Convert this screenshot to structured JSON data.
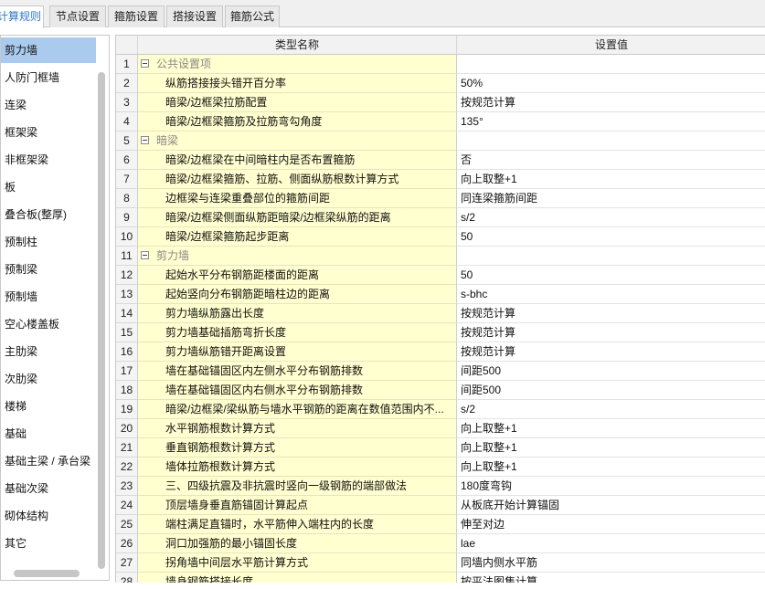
{
  "tabs": [
    {
      "label": "计算规则"
    },
    {
      "label": "节点设置"
    },
    {
      "label": "箍筋设置"
    },
    {
      "label": "搭接设置"
    },
    {
      "label": "箍筋公式"
    }
  ],
  "sidebar": {
    "items": [
      {
        "label": "剪力墙"
      },
      {
        "label": "人防门框墙"
      },
      {
        "label": "连梁"
      },
      {
        "label": "框架梁"
      },
      {
        "label": "非框架梁"
      },
      {
        "label": "板"
      },
      {
        "label": "叠合板(整厚)"
      },
      {
        "label": "预制柱"
      },
      {
        "label": "预制梁"
      },
      {
        "label": "预制墙"
      },
      {
        "label": "空心楼盖板"
      },
      {
        "label": "主肋梁"
      },
      {
        "label": "次肋梁"
      },
      {
        "label": "楼梯"
      },
      {
        "label": "基础"
      },
      {
        "label": "基础主梁 / 承台梁"
      },
      {
        "label": "基础次梁"
      },
      {
        "label": "砌体结构"
      },
      {
        "label": "其它"
      }
    ]
  },
  "grid": {
    "header": {
      "name": "类型名称",
      "value": "设置值"
    },
    "rows": [
      {
        "num": "1",
        "name": "公共设置项",
        "value": "",
        "group": true
      },
      {
        "num": "2",
        "name": "纵筋搭接接头错开百分率",
        "value": "50%"
      },
      {
        "num": "3",
        "name": "暗梁/边框梁拉筋配置",
        "value": "按规范计算"
      },
      {
        "num": "4",
        "name": "暗梁/边框梁箍筋及拉筋弯勾角度",
        "value": "135°"
      },
      {
        "num": "5",
        "name": "暗梁",
        "value": "",
        "group": true
      },
      {
        "num": "6",
        "name": "暗梁/边框梁在中间暗柱内是否布置箍筋",
        "value": "否"
      },
      {
        "num": "7",
        "name": "暗梁/边框梁箍筋、拉筋、侧面纵筋根数计算方式",
        "value": "向上取整+1"
      },
      {
        "num": "8",
        "name": "边框梁与连梁重叠部位的箍筋间距",
        "value": "同连梁箍筋间距"
      },
      {
        "num": "9",
        "name": "暗梁/边框梁侧面纵筋距暗梁/边框梁纵筋的距离",
        "value": "s/2"
      },
      {
        "num": "10",
        "name": "暗梁/边框梁箍筋起步距离",
        "value": "50"
      },
      {
        "num": "11",
        "name": "剪力墙",
        "value": "",
        "group": true
      },
      {
        "num": "12",
        "name": "起始水平分布钢筋距楼面的距离",
        "value": "50"
      },
      {
        "num": "13",
        "name": "起始竖向分布钢筋距暗柱边的距离",
        "value": "s-bhc"
      },
      {
        "num": "14",
        "name": "剪力墙纵筋露出长度",
        "value": "按规范计算"
      },
      {
        "num": "15",
        "name": "剪力墙基础插筋弯折长度",
        "value": "按规范计算"
      },
      {
        "num": "16",
        "name": "剪力墙纵筋错开距离设置",
        "value": "按规范计算"
      },
      {
        "num": "17",
        "name": "墙在基础锚固区内左侧水平分布钢筋排数",
        "value": "间距500"
      },
      {
        "num": "18",
        "name": "墙在基础锚固区内右侧水平分布钢筋排数",
        "value": "间距500"
      },
      {
        "num": "19",
        "name": "暗梁/边框梁/梁纵筋与墙水平钢筋的距离在数值范围内不...",
        "value": "s/2"
      },
      {
        "num": "20",
        "name": "水平钢筋根数计算方式",
        "value": "向上取整+1"
      },
      {
        "num": "21",
        "name": "垂直钢筋根数计算方式",
        "value": "向上取整+1"
      },
      {
        "num": "22",
        "name": "墙体拉筋根数计算方式",
        "value": "向上取整+1"
      },
      {
        "num": "23",
        "name": "三、四级抗震及非抗震时竖向一级钢筋的端部做法",
        "value": "180度弯钩"
      },
      {
        "num": "24",
        "name": "顶层墙身垂直筋锚固计算起点",
        "value": "从板底开始计算锚固"
      },
      {
        "num": "25",
        "name": "端柱满足直锚时，水平筋伸入端柱内的长度",
        "value": "伸至对边"
      },
      {
        "num": "26",
        "name": "洞口加强筋的最小锚固长度",
        "value": "lae"
      },
      {
        "num": "27",
        "name": "拐角墙中间层水平筋计算方式",
        "value": "同墙内侧水平筋"
      },
      {
        "num": "28",
        "name": "墙身钢筋搭接长度",
        "value": "按平法图集计算"
      }
    ]
  }
}
